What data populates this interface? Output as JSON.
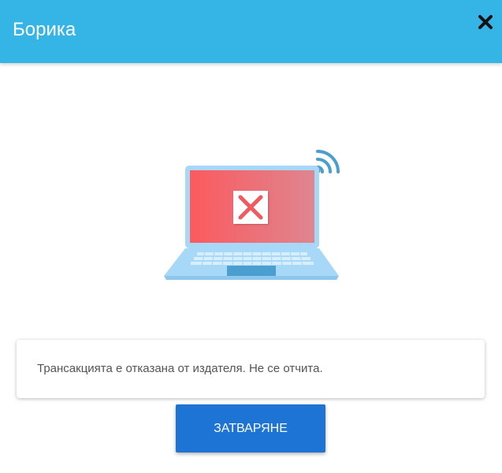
{
  "header": {
    "title": "Борика"
  },
  "colors": {
    "header_bg": "#35b5e6",
    "button_bg": "#1e74d4",
    "error_red": "#f05a5f"
  },
  "icons": {
    "close": "close-icon",
    "illustration": "laptop-error-icon"
  },
  "message": {
    "text": "Трансакцията е отказана от издателя. Не се отчита."
  },
  "actions": {
    "close_label": "ЗАТВАРЯНЕ"
  }
}
